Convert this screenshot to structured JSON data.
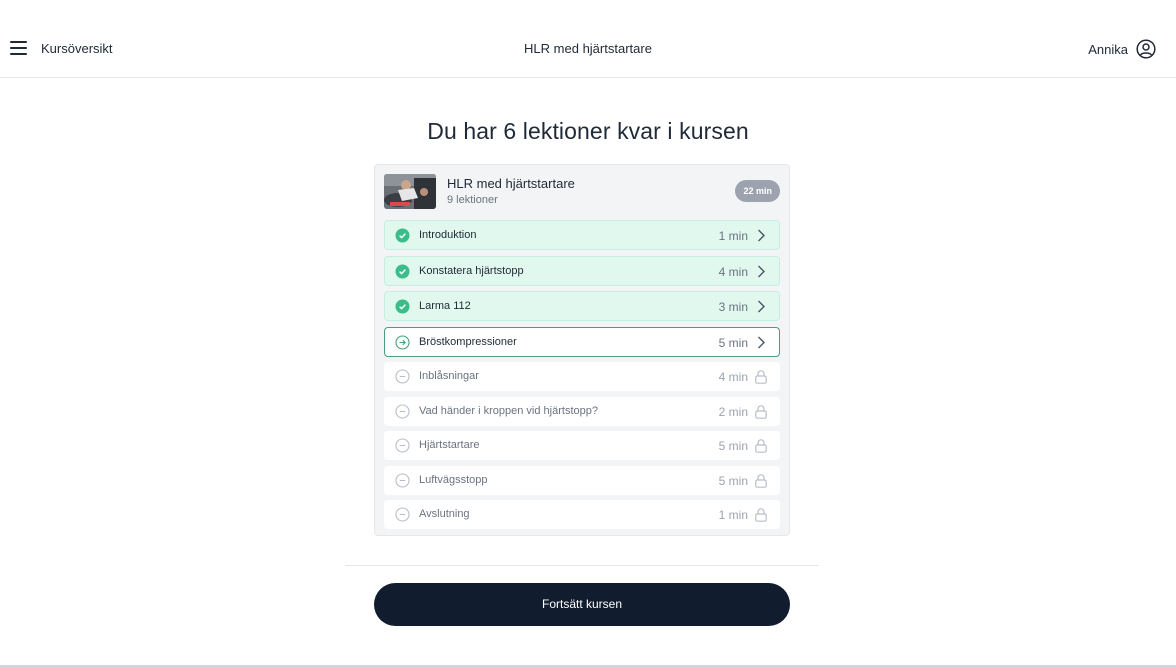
{
  "header": {
    "menu_icon": "hamburger-menu-icon",
    "overview_label": "Kursöversikt",
    "title": "HLR med hjärtstartare",
    "user_name": "Annika",
    "user_icon": "user-circle-icon"
  },
  "main": {
    "heading": "Du har 6 lektioner kvar i kursen",
    "course": {
      "name": "HLR med hjärtstartare",
      "lesson_count": "9 lektioner",
      "duration": "22 min"
    },
    "lessons": [
      {
        "label": "Introduktion",
        "duration": "1 min",
        "status": "done"
      },
      {
        "label": "Konstatera hjärtstopp",
        "duration": "4 min",
        "status": "done"
      },
      {
        "label": "Larma 112",
        "duration": "3 min",
        "status": "done"
      },
      {
        "label": "Bröstkompressioner",
        "duration": "5 min",
        "status": "current"
      },
      {
        "label": "Inblåsningar",
        "duration": "4 min",
        "status": "locked"
      },
      {
        "label": "Vad händer i kroppen vid hjärtstopp?",
        "duration": "2 min",
        "status": "locked"
      },
      {
        "label": "Hjärtstartare",
        "duration": "5 min",
        "status": "locked"
      },
      {
        "label": "Luftvägsstopp",
        "duration": "5 min",
        "status": "locked"
      },
      {
        "label": "Avslutning",
        "duration": "1 min",
        "status": "locked"
      }
    ],
    "continue_label": "Fortsätt kursen"
  },
  "colors": {
    "done_bg": "#e1f8ee",
    "done_check": "#3bbd8a",
    "current_border": "#4a9e7b",
    "button_bg": "#111d2e",
    "badge_bg": "#9ca3af"
  }
}
